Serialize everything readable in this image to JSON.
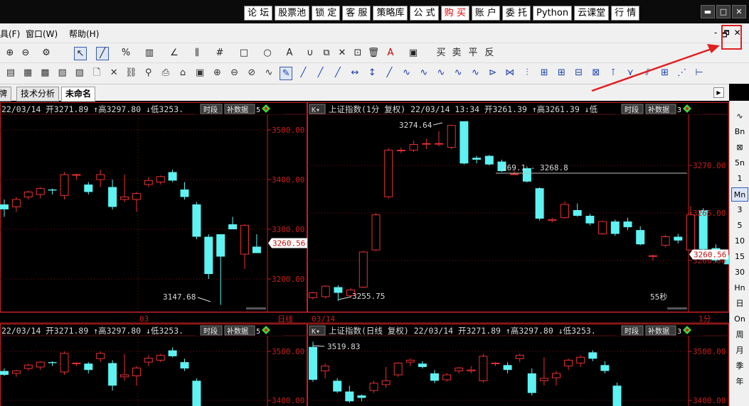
{
  "topnav": {
    "items": [
      "论 坛",
      "股票池",
      "锁 定",
      "客 服",
      "策略库",
      "公 式",
      "购 买",
      "账 户",
      "委 托",
      "Python",
      "云课堂",
      "行 情"
    ],
    "highlight_color": "#e00000"
  },
  "window_controls": {
    "minimize": "▬",
    "restore": "□",
    "close": "✕"
  },
  "menubar": {
    "items": [
      "具(F)",
      "窗口(W)",
      "帮助(H)"
    ],
    "mdi": {
      "minimize": "-",
      "restore": "🗗",
      "close": "✕"
    }
  },
  "toolbar1": {
    "icons": [
      "zoom-in-icon",
      "zoom-out-icon",
      "settings-icon",
      "cursor-icon",
      "line-tool-icon",
      "percent-tool-icon",
      "ruler-icon",
      "angle-icon",
      "parallel-lines-icon",
      "grid-icon",
      "rectangle-icon",
      "circle-icon",
      "text-icon",
      "magnet-icon",
      "copy-icon",
      "delete-icon",
      "lock-icon",
      "trash-icon",
      "color-icon",
      "save-icon"
    ],
    "glyphs": [
      "⊕",
      "⊖",
      "⚙",
      "↖",
      "╱",
      "%",
      "▥",
      "∠",
      "⫼",
      "#",
      "□",
      "○",
      "A",
      "∪",
      "⧉",
      "✕",
      "⊡",
      "🗑",
      "A",
      "▣"
    ],
    "trade_labels": [
      "买",
      "卖",
      "平",
      "反"
    ]
  },
  "toolbar2": {
    "glyphs": [
      "▤",
      "▦",
      "▩",
      "▧",
      "▨",
      "🗋",
      "✕",
      "⛓",
      "⚲",
      "⎙",
      "⌂",
      "▣",
      "⊕",
      "⊖",
      "⊘",
      "∿",
      "✎",
      "╱",
      "╱",
      "╱",
      "↔",
      "↕",
      "╱",
      "∿",
      "∿",
      "∿",
      "∿",
      "∿",
      "⊳",
      "⋈",
      "⫶",
      "⊞",
      "⊞",
      "⊟",
      "⊠",
      "⊺",
      "⋎",
      "⫽",
      "⊞",
      "⋰",
      "⊢"
    ]
  },
  "tabs": [
    "牌",
    "技术分析",
    "未命名"
  ],
  "rightbar": {
    "items": [
      "∿",
      "Bn",
      "⊠",
      "5n",
      "1",
      "Mn",
      "3",
      "5",
      "10",
      "15",
      "30",
      "Hn",
      "日",
      "On",
      "周",
      "月",
      "季",
      "年"
    ],
    "selected": "Mn"
  },
  "panels": [
    {
      "id": "top-left",
      "header": "22/03/14 开3271.89 ↑高3297.80 ↓低3253.",
      "btn_time": "时段",
      "btn_data": "补数据",
      "header_extra": "5",
      "price_labels": [
        "3500.00",
        "3400.00",
        "3300.00",
        "3200.00"
      ],
      "current_price": "3260.56",
      "low_label": "3147.68",
      "date_label": "03",
      "period_label": "日线"
    },
    {
      "id": "top-right",
      "header": "上证指数(1分 复权) 22/03/14 13:34 开3261.39 ↑高3261.39 ↓低",
      "btn_k": "K",
      "btn_time": "时段",
      "btn_data": "补数据",
      "header_extra": "3",
      "price_labels": [
        "3270.00",
        "3265.00",
        "3260.00"
      ],
      "current_price": "3260.56",
      "high_label": "3274.64",
      "low_label": "3255.75",
      "line_label": "269.1 - 3268.8",
      "countdown": "55秒",
      "date_label": "03/14",
      "period_label": "1分"
    },
    {
      "id": "bottom-left",
      "header": "22/03/14 开3271.89 ↑高3297.80 ↓低3253.",
      "btn_time": "时段",
      "btn_data": "补数据",
      "header_extra": "5",
      "price_labels": [
        "3500.00",
        "3400.00"
      ]
    },
    {
      "id": "bottom-right",
      "header": "上证指数(日线 复权) 22/03/14 开3271.89 ↑高3297.80 ↓低3253.",
      "btn_k": "K",
      "btn_time": "时段",
      "btn_data": "补数据",
      "header_extra": "3",
      "price_labels": [
        "3500.00",
        "3400.00"
      ],
      "high_label": "3519.83"
    }
  ],
  "chart_data": [
    {
      "type": "candlestick",
      "panel": "top-left (daily, partial)",
      "ylim": [
        3130,
        3540
      ],
      "candles": [
        {
          "o": 3350,
          "h": 3360,
          "l": 3325,
          "c": 3340
        },
        {
          "o": 3345,
          "h": 3365,
          "l": 3335,
          "c": 3360
        },
        {
          "o": 3365,
          "h": 3378,
          "l": 3360,
          "c": 3375
        },
        {
          "o": 3370,
          "h": 3385,
          "l": 3362,
          "c": 3382
        },
        {
          "o": 3380,
          "h": 3382,
          "l": 3370,
          "c": 3378
        },
        {
          "o": 3368,
          "h": 3415,
          "l": 3360,
          "c": 3410
        },
        {
          "o": 3410,
          "h": 3412,
          "l": 3400,
          "c": 3410
        },
        {
          "o": 3390,
          "h": 3395,
          "l": 3370,
          "c": 3375
        },
        {
          "o": 3400,
          "h": 3420,
          "l": 3385,
          "c": 3410
        },
        {
          "o": 3385,
          "h": 3400,
          "l": 3340,
          "c": 3345
        },
        {
          "o": 3360,
          "h": 3410,
          "l": 3355,
          "c": 3365
        },
        {
          "o": 3360,
          "h": 3375,
          "l": 3335,
          "c": 3372
        },
        {
          "o": 3390,
          "h": 3405,
          "l": 3385,
          "c": 3398
        },
        {
          "o": 3395,
          "h": 3408,
          "l": 3390,
          "c": 3406
        },
        {
          "o": 3415,
          "h": 3420,
          "l": 3395,
          "c": 3398
        },
        {
          "o": 3380,
          "h": 3395,
          "l": 3360,
          "c": 3365
        },
        {
          "o": 3350,
          "h": 3355,
          "l": 3280,
          "c": 3285
        },
        {
          "o": 3285,
          "h": 3290,
          "l": 3200,
          "c": 3210
        },
        {
          "o": 3290,
          "h": 3290,
          "l": 3147.68,
          "c": 3245
        },
        {
          "o": 3310,
          "h": 3325,
          "l": 3300,
          "c": 3300
        },
        {
          "o": 3250,
          "h": 3310,
          "l": 3220,
          "c": 3308
        },
        {
          "o": 3265,
          "h": 3290,
          "l": 3255,
          "c": 3252
        }
      ]
    },
    {
      "type": "candlestick",
      "panel": "top-right (1 min)",
      "ylim": [
        3253.5,
        3276
      ],
      "candles": [
        {
          "o": 3256.1,
          "h": 3256.7,
          "l": 3255.9,
          "c": 3256.6
        },
        {
          "o": 3256.2,
          "h": 3257.4,
          "l": 3256.0,
          "c": 3257.3
        },
        {
          "o": 3257.2,
          "h": 3257.4,
          "l": 3255.75,
          "c": 3256.6
        },
        {
          "o": 3256.3,
          "h": 3257.1,
          "l": 3256.1,
          "c": 3256.9
        },
        {
          "o": 3257.2,
          "h": 3261.0,
          "l": 3257.1,
          "c": 3260.9
        },
        {
          "o": 3261.1,
          "h": 3265.0,
          "l": 3261.0,
          "c": 3264.8
        },
        {
          "o": 3266.7,
          "h": 3271.8,
          "l": 3266.5,
          "c": 3271.6
        },
        {
          "o": 3271.6,
          "h": 3271.9,
          "l": 3271.3,
          "c": 3271.6
        },
        {
          "o": 3271.6,
          "h": 3272.6,
          "l": 3271.4,
          "c": 3272.2
        },
        {
          "o": 3272.3,
          "h": 3272.8,
          "l": 3271.7,
          "c": 3272.3
        },
        {
          "o": 3272.3,
          "h": 3273.6,
          "l": 3272.0,
          "c": 3272.3
        },
        {
          "o": 3271.9,
          "h": 3274.3,
          "l": 3271.7,
          "c": 3274.2
        },
        {
          "o": 3274.64,
          "h": 3274.64,
          "l": 3270.1,
          "c": 3270.2
        },
        {
          "o": 3270.8,
          "h": 3271.0,
          "l": 3270.2,
          "c": 3270.6
        },
        {
          "o": 3271.0,
          "h": 3271.1,
          "l": 3270.0,
          "c": 3270.1
        },
        {
          "o": 3270.4,
          "h": 3270.6,
          "l": 3269.3,
          "c": 3269.4
        },
        {
          "o": 3269.1,
          "h": 3269.4,
          "l": 3269.0,
          "c": 3269.1
        },
        {
          "o": 3269.7,
          "h": 3269.9,
          "l": 3268.2,
          "c": 3268.3
        },
        {
          "o": 3267.6,
          "h": 3267.7,
          "l": 3264.2,
          "c": 3264.4
        },
        {
          "o": 3264.2,
          "h": 3264.5,
          "l": 3264.0,
          "c": 3264.3
        },
        {
          "o": 3264.5,
          "h": 3266.2,
          "l": 3264.4,
          "c": 3265.9
        },
        {
          "o": 3265.3,
          "h": 3266.0,
          "l": 3264.6,
          "c": 3264.7
        },
        {
          "o": 3264.7,
          "h": 3264.9,
          "l": 3263.7,
          "c": 3263.9
        },
        {
          "o": 3262.8,
          "h": 3264.2,
          "l": 3262.7,
          "c": 3264.1
        },
        {
          "o": 3264.1,
          "h": 3264.3,
          "l": 3262.6,
          "c": 3262.8
        },
        {
          "o": 3264.1,
          "h": 3264.5,
          "l": 3263.2,
          "c": 3263.5
        },
        {
          "o": 3263.2,
          "h": 3263.6,
          "l": 3261.6,
          "c": 3261.7
        },
        {
          "o": 3260.5,
          "h": 3260.6,
          "l": 3260.0,
          "c": 3260.5
        },
        {
          "o": 3261.6,
          "h": 3262.7,
          "l": 3261.4,
          "c": 3262.5
        },
        {
          "o": 3262.5,
          "h": 3262.8,
          "l": 3261.8,
          "c": 3262.1
        },
        {
          "o": 3261.1,
          "h": 3265.7,
          "l": 3261.0,
          "c": 3264.8
        },
        {
          "o": 3265.3,
          "h": 3265.5,
          "l": 3261.1,
          "c": 3261.2
        },
        {
          "o": 3261.3,
          "h": 3261.7,
          "l": 3259.8,
          "c": 3260.0
        },
        {
          "o": 3260.5,
          "h": 3260.6,
          "l": 3259.6,
          "c": 3259.6
        }
      ]
    },
    {
      "type": "candlestick",
      "panel": "bottom-left (daily, partial)",
      "ylim": [
        3380,
        3540
      ],
      "candles": [
        {
          "o": 3460,
          "h": 3465,
          "l": 3450,
          "c": 3452
        },
        {
          "o": 3455,
          "h": 3462,
          "l": 3448,
          "c": 3460
        },
        {
          "o": 3465,
          "h": 3475,
          "l": 3460,
          "c": 3472
        },
        {
          "o": 3468,
          "h": 3480,
          "l": 3462,
          "c": 3478
        },
        {
          "o": 3478,
          "h": 3480,
          "l": 3470,
          "c": 3476
        },
        {
          "o": 3458,
          "h": 3500,
          "l": 3452,
          "c": 3496
        },
        {
          "o": 3476,
          "h": 3478,
          "l": 3470,
          "c": 3476
        },
        {
          "o": 3475,
          "h": 3478,
          "l": 3455,
          "c": 3462
        },
        {
          "o": 3485,
          "h": 3500,
          "l": 3478,
          "c": 3496
        },
        {
          "o": 3476,
          "h": 3482,
          "l": 3420,
          "c": 3430
        },
        {
          "o": 3448,
          "h": 3495,
          "l": 3440,
          "c": 3452
        },
        {
          "o": 3450,
          "h": 3470,
          "l": 3430,
          "c": 3466
        },
        {
          "o": 3478,
          "h": 3492,
          "l": 3470,
          "c": 3486
        },
        {
          "o": 3482,
          "h": 3495,
          "l": 3478,
          "c": 3492
        },
        {
          "o": 3502,
          "h": 3508,
          "l": 3488,
          "c": 3490
        },
        {
          "o": 3478,
          "h": 3485,
          "l": 3460,
          "c": 3465
        },
        {
          "o": 3440,
          "h": 3445,
          "l": 3380,
          "c": 3380
        }
      ]
    },
    {
      "type": "candlestick",
      "panel": "bottom-right (daily)",
      "ylim": [
        3380,
        3540
      ],
      "candles": [
        {
          "o": 3509,
          "h": 3519.83,
          "l": 3438,
          "c": 3442
        },
        {
          "o": 3460,
          "h": 3475,
          "l": 3445,
          "c": 3470
        },
        {
          "o": 3440,
          "h": 3445,
          "l": 3415,
          "c": 3418
        },
        {
          "o": 3418,
          "h": 3430,
          "l": 3395,
          "c": 3398
        },
        {
          "o": 3410,
          "h": 3412,
          "l": 3398,
          "c": 3405
        },
        {
          "o": 3420,
          "h": 3440,
          "l": 3415,
          "c": 3435
        },
        {
          "o": 3432,
          "h": 3468,
          "l": 3425,
          "c": 3440
        },
        {
          "o": 3452,
          "h": 3478,
          "l": 3448,
          "c": 3476
        },
        {
          "o": 3478,
          "h": 3485,
          "l": 3470,
          "c": 3482
        },
        {
          "o": 3475,
          "h": 3480,
          "l": 3465,
          "c": 3468
        },
        {
          "o": 3455,
          "h": 3462,
          "l": 3435,
          "c": 3440
        },
        {
          "o": 3442,
          "h": 3456,
          "l": 3438,
          "c": 3452
        },
        {
          "o": 3460,
          "h": 3468,
          "l": 3455,
          "c": 3466
        },
        {
          "o": 3460,
          "h": 3470,
          "l": 3455,
          "c": 3462
        },
        {
          "o": 3440,
          "h": 3495,
          "l": 3436,
          "c": 3490
        },
        {
          "o": 3476,
          "h": 3478,
          "l": 3470,
          "c": 3476
        },
        {
          "o": 3472,
          "h": 3478,
          "l": 3455,
          "c": 3462
        },
        {
          "o": 3485,
          "h": 3495,
          "l": 3478,
          "c": 3492
        },
        {
          "o": 3455,
          "h": 3465,
          "l": 3410,
          "c": 3415
        },
        {
          "o": 3440,
          "h": 3488,
          "l": 3430,
          "c": 3445
        },
        {
          "o": 3446,
          "h": 3460,
          "l": 3430,
          "c": 3455
        },
        {
          "o": 3470,
          "h": 3485,
          "l": 3462,
          "c": 3482
        },
        {
          "o": 3476,
          "h": 3492,
          "l": 3468,
          "c": 3488
        },
        {
          "o": 3498,
          "h": 3502,
          "l": 3480,
          "c": 3485
        },
        {
          "o": 3472,
          "h": 3480,
          "l": 3455,
          "c": 3460
        },
        {
          "o": 3430,
          "h": 3436,
          "l": 3380,
          "c": 3380
        }
      ]
    }
  ],
  "colors": {
    "up": "#e83030",
    "down": "#5ef2f2",
    "axis": "#c82020",
    "text": "#d9d9d9",
    "price_tag_bg": "#ffffff",
    "header_up": "#ff4040",
    "header_down": "#5ef2f2",
    "annotation": "#e02020"
  }
}
